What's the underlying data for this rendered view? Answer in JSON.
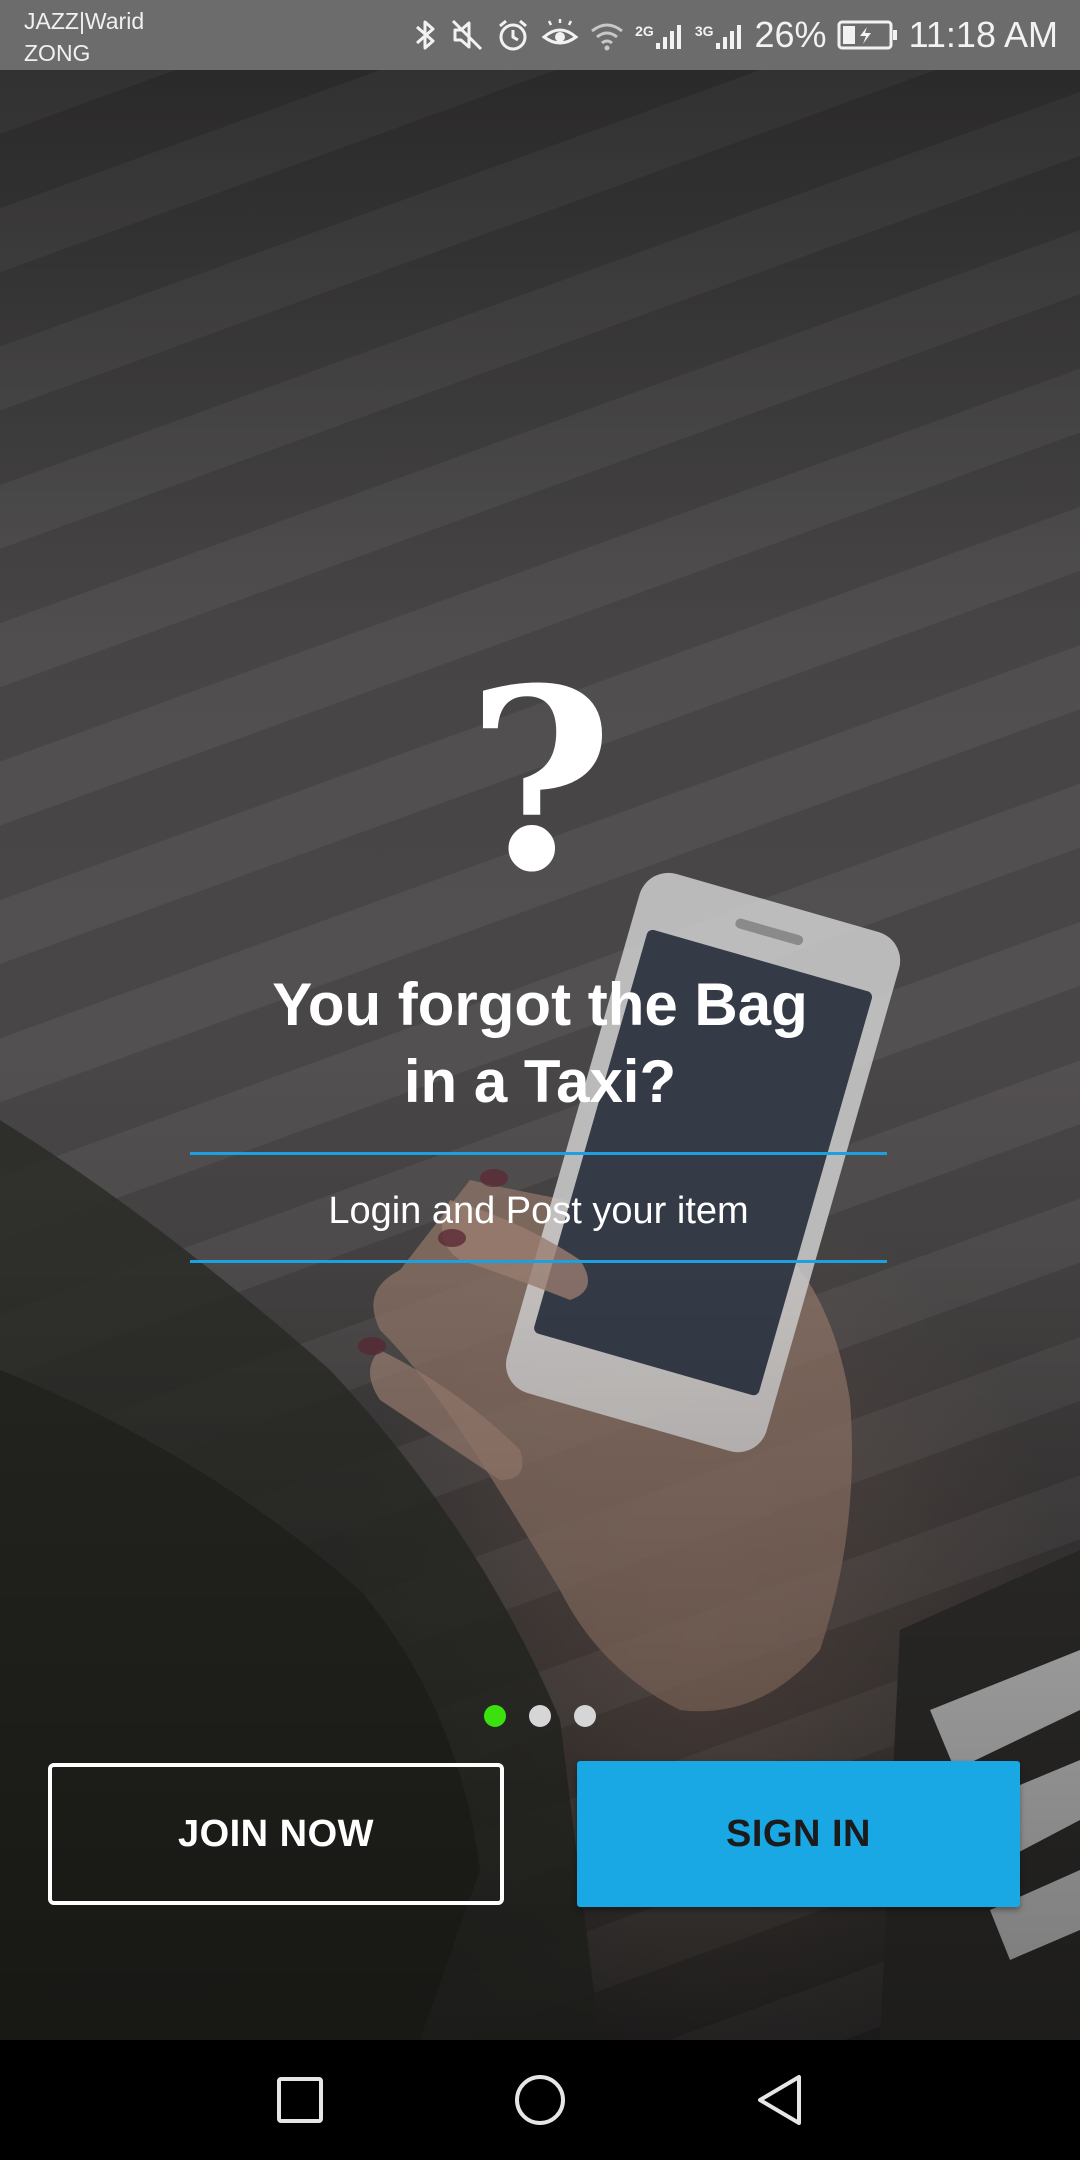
{
  "status_bar": {
    "carrier_primary": "JAZZ|Warid",
    "carrier_secondary": "ZONG",
    "network_1": "2G",
    "network_2": "3G",
    "battery_percent": "26%",
    "time": "11:18 AM",
    "icons": [
      "bluetooth-icon",
      "mute-icon",
      "alarm-icon",
      "eye-comfort-icon",
      "wifi-icon",
      "signal-icon",
      "signal-icon",
      "battery-charging-icon"
    ]
  },
  "onboarding": {
    "icon_glyph": "?",
    "headline_line1": "You forgot the Bag",
    "headline_line2": "in a Taxi?",
    "subtitle": "Login and Post your item",
    "page_count": 3,
    "active_page": 1,
    "accent_color": "#1aa8e4",
    "indicator_active_color": "#3be10f"
  },
  "actions": {
    "join_label": "JOIN NOW",
    "signin_label": "SIGN IN"
  },
  "nav_bar": {
    "icons": [
      "recent-apps-icon",
      "home-icon",
      "back-icon"
    ]
  }
}
